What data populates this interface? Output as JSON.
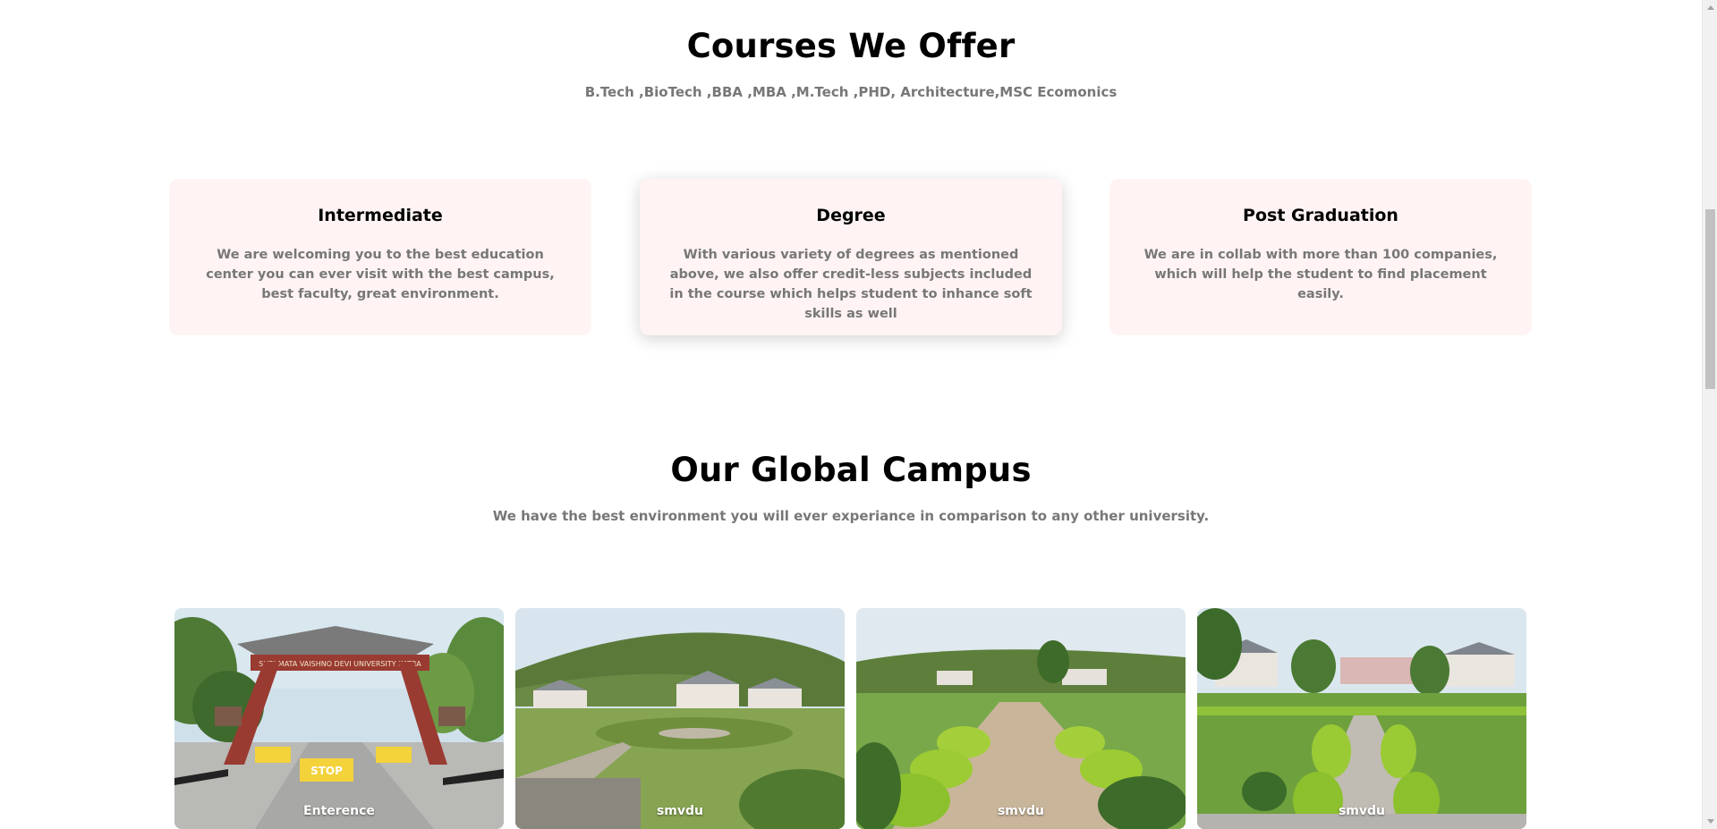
{
  "courses": {
    "title": "Courses We Offer",
    "subtitle": "B.Tech ,BioTech ,BBA ,MBA ,M.Tech ,PHD, Architecture,MSC Ecomonics",
    "cards": [
      {
        "title": "Intermediate",
        "text": "We are welcoming you to the best education center you can ever visit with the best campus, best faculty, great environment."
      },
      {
        "title": "Degree",
        "text": "With various variety of degrees as mentioned above, we also offer credit-less subjects included in the course which helps student to inhance soft skills as well"
      },
      {
        "title": "Post Graduation",
        "text": "We are in collab with more than 100 companies, which will help the student to find placement easily."
      }
    ]
  },
  "campus": {
    "title": "Our Global Campus",
    "subtitle": "We have the best environment you will ever experiance in comparison to any other university.",
    "photos": [
      {
        "caption": "Enterence",
        "gate_text": "SHRI MATA VAISHNO DEVI UNIVERSITY KATRA",
        "sign_text": "STOP"
      },
      {
        "caption": "smvdu"
      },
      {
        "caption": "smvdu"
      },
      {
        "caption": "smvdu"
      }
    ]
  },
  "colors": {
    "card_bg": "#fff3f3",
    "muted_text": "#777777",
    "heading": "#000000"
  }
}
